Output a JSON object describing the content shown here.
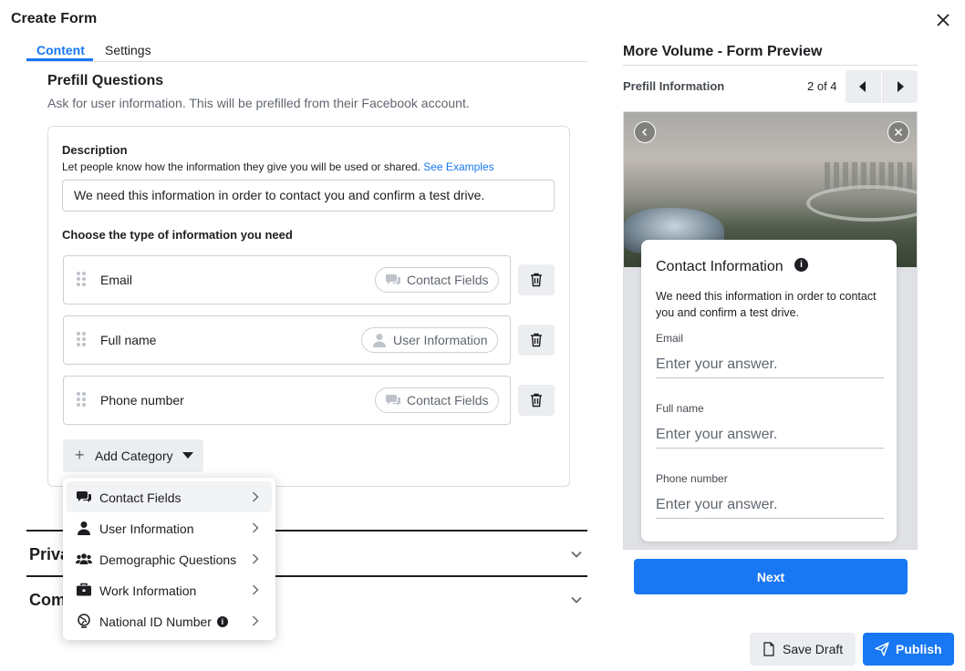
{
  "dialog": {
    "title": "Create Form"
  },
  "tabs": [
    {
      "label": "Content",
      "active": true
    },
    {
      "label": "Settings",
      "active": false
    }
  ],
  "prefill": {
    "heading": "Prefill Questions",
    "subheading": "Ask for user information. This will be prefilled from their Facebook account.",
    "description_label": "Description",
    "description_help": "Let people know how the information they give you will be used or shared.",
    "see_examples": "See Examples",
    "description_value": "We need this information in order to contact you and confirm a test drive.",
    "choose_label": "Choose the type of information you need",
    "fields": [
      {
        "label": "Email",
        "category": "Contact Fields",
        "icon": "chat-bubbles-icon"
      },
      {
        "label": "Full name",
        "category": "User Information",
        "icon": "person-icon"
      },
      {
        "label": "Phone number",
        "category": "Contact Fields",
        "icon": "chat-bubbles-icon"
      }
    ],
    "add_category": "Add Category"
  },
  "menu": {
    "items": [
      {
        "label": "Contact Fields",
        "icon": "chat-bubbles-icon",
        "highlighted": true
      },
      {
        "label": "User Information",
        "icon": "person-icon"
      },
      {
        "label": "Demographic Questions",
        "icon": "group-icon"
      },
      {
        "label": "Work Information",
        "icon": "briefcase-icon"
      },
      {
        "label": "National ID Number",
        "icon": "globe-icon",
        "info": "i"
      }
    ]
  },
  "sections": [
    {
      "label": "Priva"
    },
    {
      "label": "Com"
    }
  ],
  "preview": {
    "title": "More Volume - Form Preview",
    "step_label": "Prefill Information",
    "page_count": "2 of 4",
    "card_title": "Contact Information",
    "card_info": "i",
    "card_desc": "We need this information in order to contact you and confirm a test drive.",
    "questions": [
      {
        "label": "Email",
        "placeholder": "Enter your answer."
      },
      {
        "label": "Full name",
        "placeholder": "Enter your answer."
      },
      {
        "label": "Phone number",
        "placeholder": "Enter your answer."
      }
    ],
    "next": "Next"
  },
  "footer": {
    "save_draft": "Save Draft",
    "publish": "Publish"
  },
  "colors": {
    "accent": "#1877f2",
    "border": "#ccd0d5",
    "muted": "#606770",
    "button_bg": "#ebedf0"
  }
}
